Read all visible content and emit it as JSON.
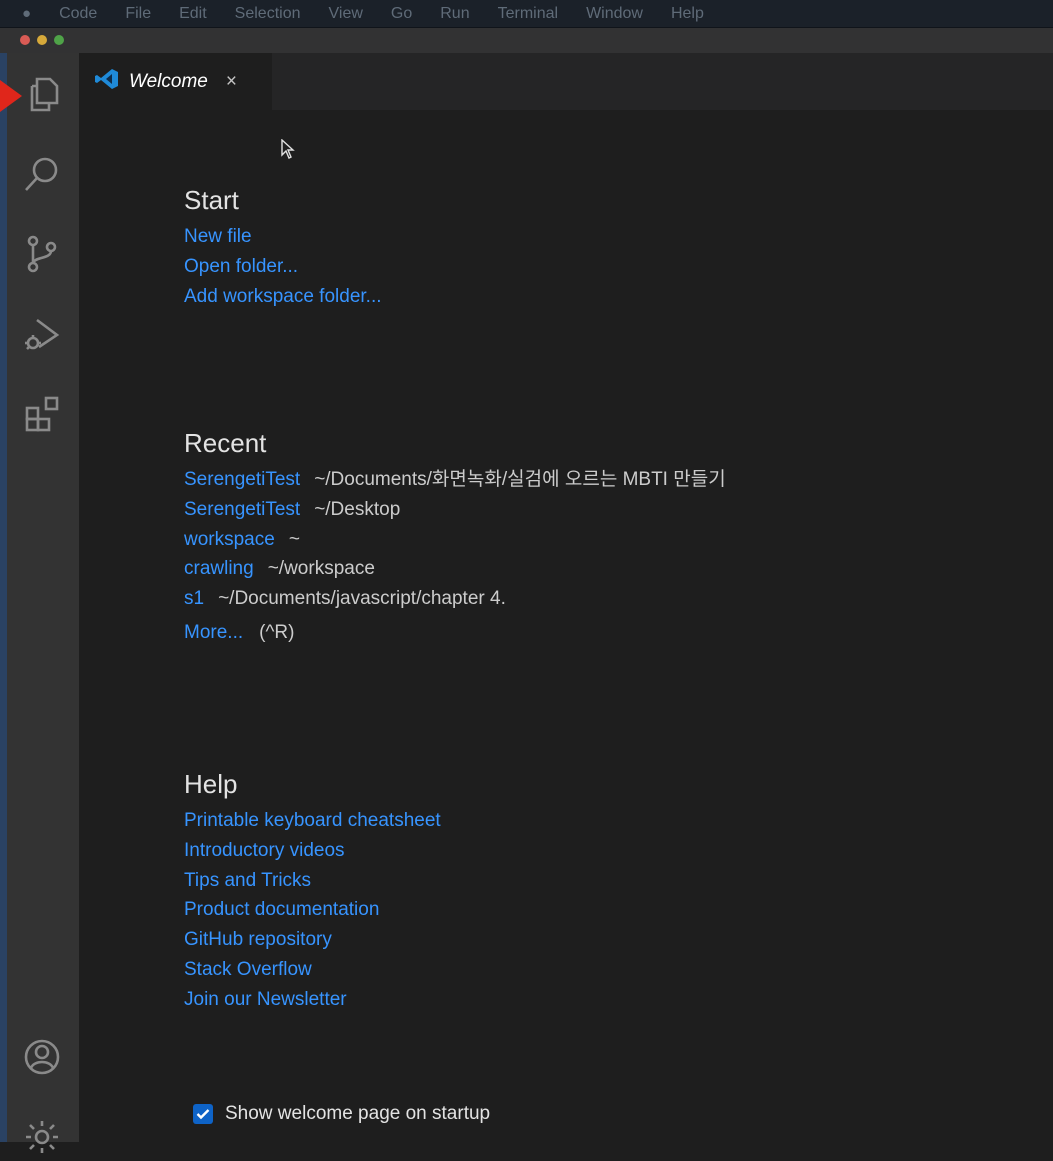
{
  "menubar": {
    "items": [
      "Code",
      "File",
      "Edit",
      "Selection",
      "View",
      "Go",
      "Run",
      "Terminal",
      "Window",
      "Help"
    ]
  },
  "activity_bar": {
    "icons": [
      "explorer-icon",
      "search-icon",
      "source-control-icon",
      "run-debug-icon",
      "extensions-icon",
      "account-icon",
      "settings-gear-icon"
    ]
  },
  "tab": {
    "title": "Welcome",
    "close_glyph": "×"
  },
  "start": {
    "title": "Start",
    "links": [
      "New file",
      "Open folder...",
      "Add workspace folder..."
    ]
  },
  "recent": {
    "title": "Recent",
    "items": [
      {
        "name": "SerengetiTest",
        "path": "~/Documents/화면녹화/실검에 오르는 MBTI 만들기"
      },
      {
        "name": "SerengetiTest",
        "path": "~/Desktop"
      },
      {
        "name": "workspace",
        "path": "~"
      },
      {
        "name": "crawling",
        "path": "~/workspace"
      },
      {
        "name": "s1",
        "path": "~/Documents/javascript/chapter 4."
      }
    ],
    "more_label": "More...",
    "more_shortcut": "(^R)"
  },
  "help": {
    "title": "Help",
    "links": [
      "Printable keyboard cheatsheet",
      "Introductory videos",
      "Tips and Tricks",
      "Product documentation",
      "GitHub repository",
      "Stack Overflow",
      "Join our Newsletter"
    ]
  },
  "startup": {
    "label": "Show welcome page on startup",
    "checked": true
  },
  "colors": {
    "link": "#3794ff",
    "activity_bar": "#333333",
    "editor_bg": "#1e1e1e",
    "arrow": "#e0261b"
  }
}
